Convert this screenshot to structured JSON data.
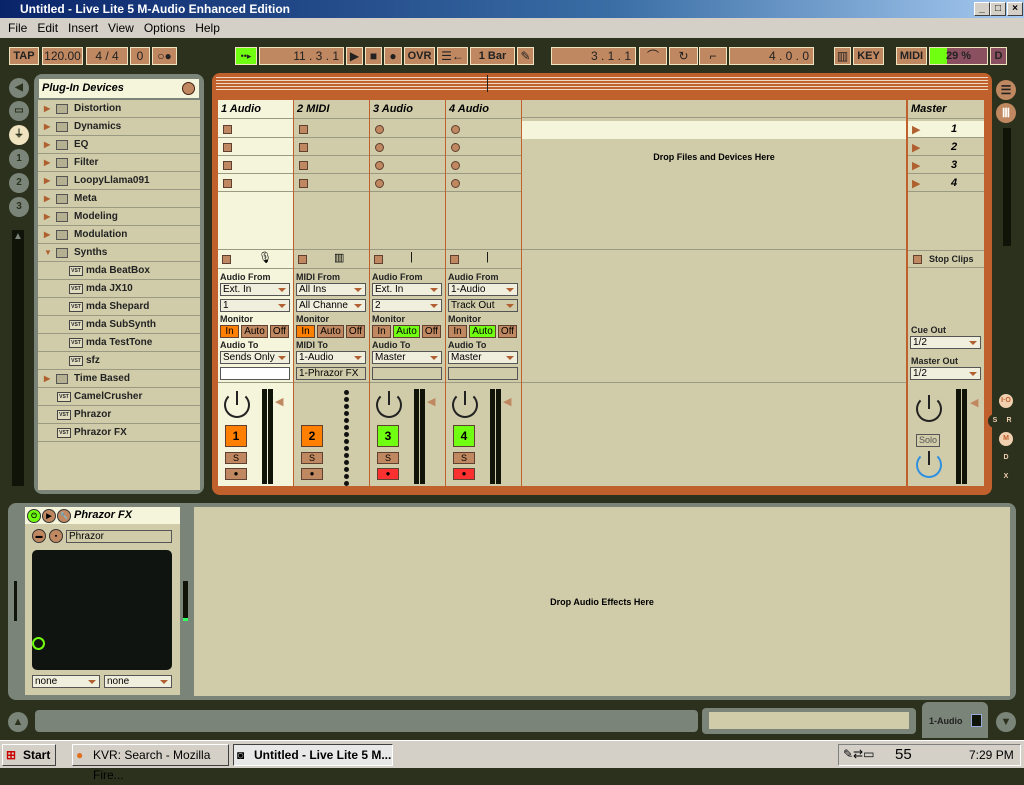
{
  "window": {
    "title": "Untitled - Live Lite 5 M-Audio Enhanced Edition",
    "controls": [
      "_",
      "□",
      "×"
    ]
  },
  "menu": [
    "File",
    "Edit",
    "Insert",
    "View",
    "Options",
    "Help"
  ],
  "transport": {
    "tap": "TAP",
    "tempo": "120.00",
    "signature": "4 / 4",
    "nudge": "0",
    "metronome": "○●",
    "follow": "••▸",
    "position": "11 .   3 .   1",
    "ovr": "OVR",
    "quantize": "1 Bar",
    "loop_start": "3 .   1 .   1",
    "loop_length": "4 .   0 .   0",
    "key": "KEY",
    "midi": "MIDI",
    "cpu": "29 %",
    "cpu_fraction": 0.29,
    "disk": "D",
    "accent": "#70ff10"
  },
  "browser": {
    "title": "Plug-In Devices",
    "items": [
      {
        "label": "Distortion",
        "type": "folder"
      },
      {
        "label": "Dynamics",
        "type": "folder"
      },
      {
        "label": "EQ",
        "type": "folder"
      },
      {
        "label": "Filter",
        "type": "folder"
      },
      {
        "label": "LoopyLlama091",
        "type": "folder"
      },
      {
        "label": "Meta",
        "type": "folder"
      },
      {
        "label": "Modeling",
        "type": "folder"
      },
      {
        "label": "Modulation",
        "type": "folder"
      },
      {
        "label": "Synths",
        "type": "open-folder"
      },
      {
        "label": "mda BeatBox",
        "type": "vst-child"
      },
      {
        "label": "mda JX10",
        "type": "vst-child"
      },
      {
        "label": "mda Shepard",
        "type": "vst-child"
      },
      {
        "label": "mda SubSynth",
        "type": "vst-child"
      },
      {
        "label": "mda TestTone",
        "type": "vst-child"
      },
      {
        "label": "sfz",
        "type": "vst-child"
      },
      {
        "label": "Time Based",
        "type": "folder"
      },
      {
        "label": "CamelCrusher",
        "type": "vst"
      },
      {
        "label": "Phrazor",
        "type": "vst"
      },
      {
        "label": "Phrazor FX",
        "type": "vst"
      }
    ]
  },
  "session": {
    "drop_text": "Drop Files and Devices Here",
    "tracks": [
      {
        "name": "1 Audio",
        "from_label": "Audio From",
        "from": "Ext. In",
        "channel": "1",
        "to_label": "Audio To",
        "to": "Sends Only",
        "to_sub": "",
        "monitor": "In",
        "number": "1",
        "color": "#ff8000",
        "arm": "#c08860"
      },
      {
        "name": "2 MIDI",
        "from_label": "MIDI From",
        "from": "All Ins",
        "channel": "All Channe",
        "to_label": "MIDI To",
        "to": "1-Audio",
        "to_sub": "1-Phrazor FX",
        "monitor": "In",
        "number": "2",
        "color": "#ff8000",
        "arm": "#c08860"
      },
      {
        "name": "3 Audio",
        "from_label": "Audio From",
        "from": "Ext. In",
        "channel": "2",
        "to_label": "Audio To",
        "to": "Master",
        "to_sub": "",
        "monitor": "Auto",
        "number": "3",
        "color": "#70ff10",
        "arm": "#ff3030"
      },
      {
        "name": "4 Audio",
        "from_label": "Audio From",
        "from": "1-Audio",
        "channel": "Track Out",
        "to_label": "Audio To",
        "to": "Master",
        "to_sub": "",
        "monitor": "Auto",
        "number": "4",
        "color": "#70ff10",
        "arm": "#ff3030"
      }
    ],
    "monitor_label": "Monitor",
    "monitor_options": [
      "In",
      "Auto",
      "Off"
    ],
    "solo": "S",
    "master": {
      "name": "Master",
      "scenes": [
        "1",
        "2",
        "3",
        "4"
      ],
      "stop": "Stop Clips",
      "cue_label": "Cue Out",
      "cue": "1/2",
      "out_label": "Master Out",
      "out": "1/2",
      "solo": "Solo"
    },
    "side_buttons": [
      "I·O",
      "S",
      "R",
      "M",
      "D",
      "X"
    ]
  },
  "device": {
    "name": "Phrazor FX",
    "preset": "Phrazor",
    "sel1": "none",
    "sel2": "none",
    "drop_text": "Drop Audio Effects Here"
  },
  "status": {
    "track": "1-Audio"
  },
  "taskbar": {
    "start": "Start",
    "tasks": [
      "KVR: Search - Mozilla Fire...",
      "Untitled - Live Lite 5 M..."
    ],
    "tray_num": "55",
    "clock": "7:29 PM"
  }
}
